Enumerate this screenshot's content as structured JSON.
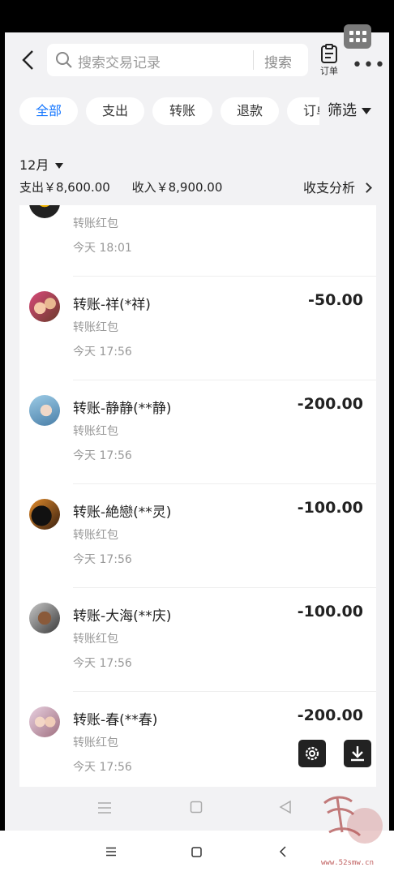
{
  "header": {
    "search_placeholder": "搜索交易记录",
    "search_button": "搜索",
    "orders_label": "订单"
  },
  "tabs": [
    "全部",
    "支出",
    "转账",
    "退款",
    "订单"
  ],
  "filter_label": "筛选",
  "summary": {
    "month": "12月",
    "expense": "支出￥8,600.00",
    "income": "收入￥8,900.00",
    "analysis": "收支分析"
  },
  "transactions": [
    {
      "title": "",
      "type": "转账红包",
      "time": "今天 18:01",
      "amount": ""
    },
    {
      "title": "转账-祥(*祥)",
      "type": "转账红包",
      "time": "今天 17:56",
      "amount": "-50.00"
    },
    {
      "title": "转账-静静(**静)",
      "type": "转账红包",
      "time": "今天 17:56",
      "amount": "-200.00"
    },
    {
      "title": "转账-絶戀(**灵)",
      "type": "转账红包",
      "time": "今天 17:56",
      "amount": "-100.00"
    },
    {
      "title": "转账-大海(**庆)",
      "type": "转账红包",
      "time": "今天 17:56",
      "amount": "-100.00"
    },
    {
      "title": "转账-春(**春)",
      "type": "转账红包",
      "time": "今天 17:56",
      "amount": "-200.00"
    }
  ],
  "watermark": {
    "url": "www.52smw.cn"
  },
  "colors": {
    "accent": "#1677ff",
    "background": "#f2f2f4"
  }
}
